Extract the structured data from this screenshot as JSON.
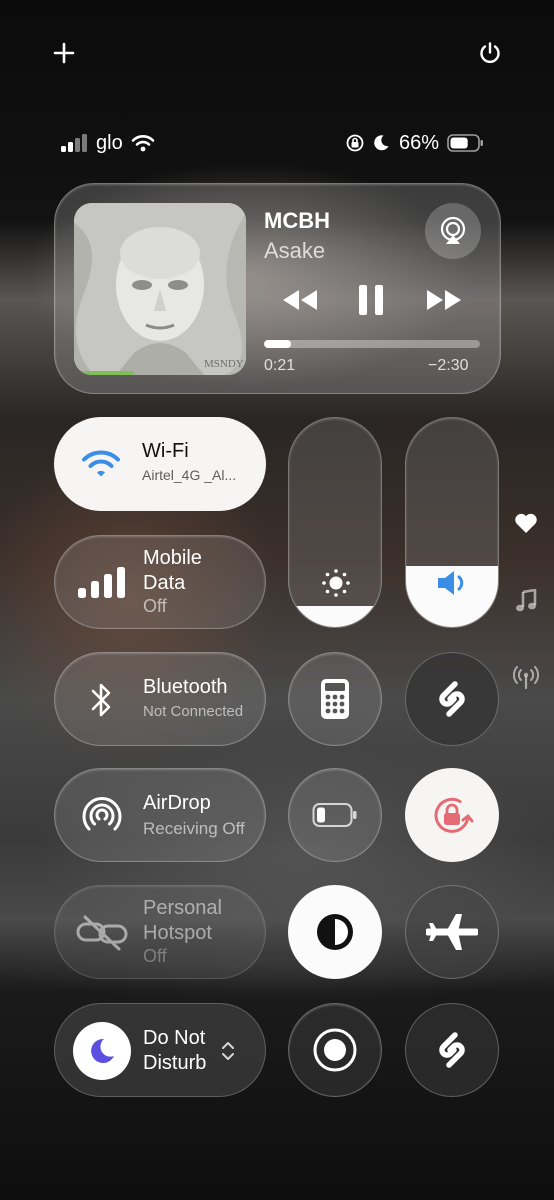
{
  "status_bar": {
    "carrier": "glo",
    "battery_percent": "66%",
    "battery_level": 0.66,
    "icons": [
      "signal-icon",
      "wifi-icon",
      "orientation-lock-icon",
      "moon-icon",
      "battery-icon"
    ]
  },
  "top_bar": {
    "icons": [
      "plus-icon",
      "power-icon"
    ]
  },
  "now_playing": {
    "title": "MCBH",
    "artist": "Asake",
    "elapsed": "0:21",
    "remaining": "−2:30",
    "progress": 0.125,
    "album_art_text": "MSNDY"
  },
  "toggles": {
    "wifi": {
      "label": "Wi-Fi",
      "sublabel": "Airtel_4G _Al...",
      "on": true
    },
    "mobile_data": {
      "label_line1": "Mobile",
      "label_line2": "Data",
      "sublabel": "Off"
    },
    "bluetooth": {
      "label": "Bluetooth",
      "sublabel": "Not Connected"
    },
    "airdrop": {
      "label": "AirDrop",
      "sublabel": "Receiving Off"
    },
    "hotspot": {
      "label_line1": "Personal",
      "label_line2": "Hotspot",
      "sublabel": "Off"
    },
    "focus": {
      "label_line1": "Do Not",
      "label_line2": "Disturb"
    }
  },
  "sliders": {
    "brightness_level": 0.1,
    "volume_level": 0.29
  },
  "colors": {
    "accent_blue": "#3a8ee6",
    "focus_purple": "#5b4fe0",
    "rotation_lock_red": "#e46b73",
    "toggle_on_bg": "#f7f5f3"
  },
  "side_icons": [
    "heart-icon",
    "music-note-icon",
    "antenna-icon"
  ]
}
